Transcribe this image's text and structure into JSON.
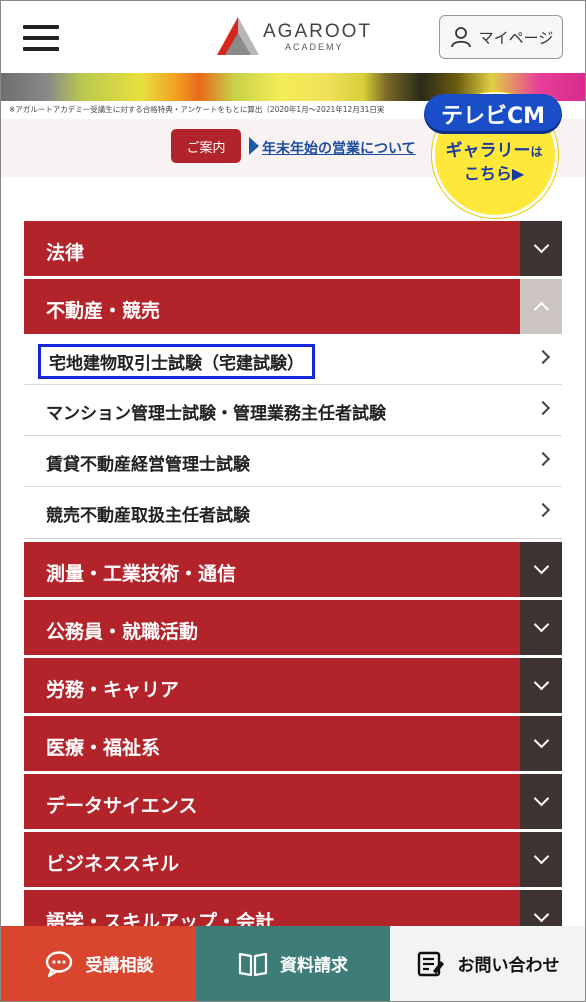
{
  "header": {
    "logo_main": "AGAROOT",
    "logo_sub": "ACADEMY",
    "mypage_label": "マイページ"
  },
  "banner": {
    "disclaimer": "※アガルートアカデミー受講生に対する合格特典・アンケートをもとに算出（2020年1月～2021年12月31日実"
  },
  "notice": {
    "badge": "ご案内",
    "link": "年末年始の営業について"
  },
  "tvcm": {
    "line1": "テレビCM",
    "line2": "ギャラリー",
    "line2_small": "は",
    "line3": "こちら▶"
  },
  "menu": {
    "categories": [
      {
        "label": "法律"
      },
      {
        "label": "不動産・競売"
      },
      {
        "label": "測量・工業技術・通信"
      },
      {
        "label": "公務員・就職活動"
      },
      {
        "label": "労務・キャリア"
      },
      {
        "label": "医療・福祉系"
      },
      {
        "label": "データサイエンス"
      },
      {
        "label": "ビジネススキル"
      },
      {
        "label": "語学・スキルアップ・会計"
      }
    ],
    "subitems": [
      {
        "label": "宅地建物取引士試験（宅建試験）"
      },
      {
        "label": "マンション管理士試験・管理業務主任者試験"
      },
      {
        "label": "賃貸不動産経営管理士試験"
      },
      {
        "label": "競売不動産取扱主任者試験"
      }
    ]
  },
  "bottom_bar": {
    "consult": "受講相談",
    "request": "資料請求",
    "contact": "お問い合わせ"
  }
}
